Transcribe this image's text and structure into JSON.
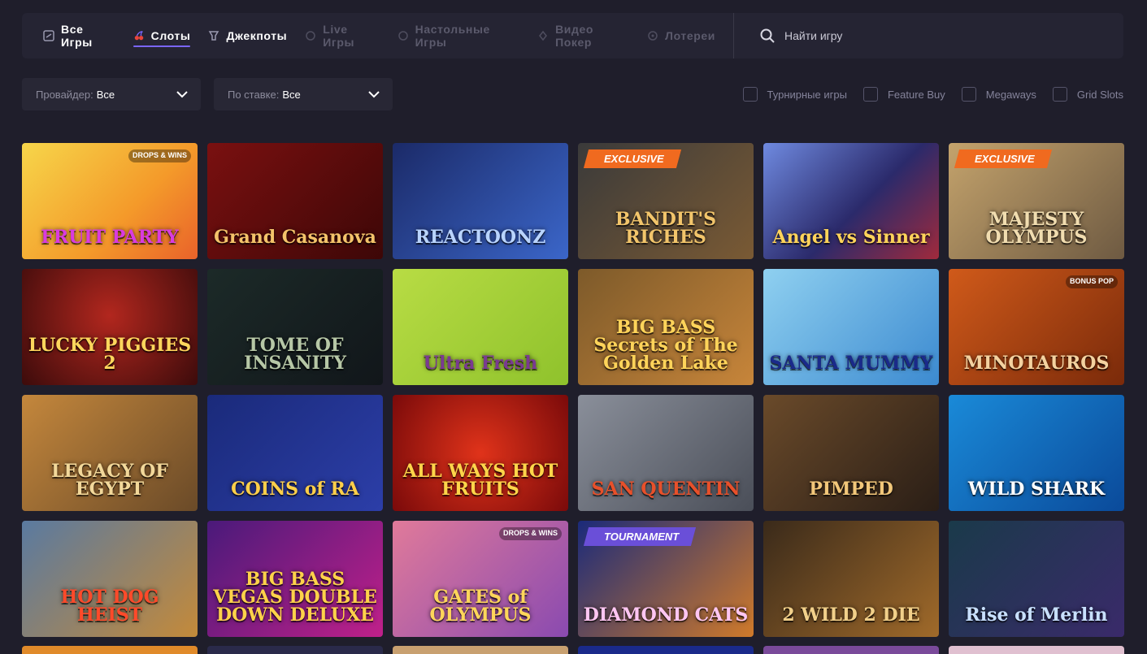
{
  "nav": {
    "categories": [
      {
        "label": "Все Игры",
        "icon": "all-games-icon",
        "active": false,
        "dim": false
      },
      {
        "label": "Слоты",
        "icon": "slots-cherry-icon",
        "active": true,
        "dim": false
      },
      {
        "label": "Джекпоты",
        "icon": "jackpot-icon",
        "active": false,
        "dim": false
      },
      {
        "label": "Live Игры",
        "icon": "live-icon",
        "active": false,
        "dim": true
      },
      {
        "label": "Настольные Игры",
        "icon": "table-games-icon",
        "active": false,
        "dim": true
      },
      {
        "label": "Видео Покер",
        "icon": "video-poker-icon",
        "active": false,
        "dim": true
      },
      {
        "label": "Лотереи",
        "icon": "lottery-icon",
        "active": false,
        "dim": true
      }
    ],
    "search_placeholder": "Найти игру"
  },
  "filters": {
    "provider_key": "Провайдер:",
    "provider_value": "Все",
    "bet_key": "По ставке:",
    "bet_value": "Все",
    "checkboxes": [
      "Турнирные игры",
      "Feature Buy",
      "Megaways",
      "Grid Slots"
    ]
  },
  "games": [
    {
      "title": "FRUIT PARTY",
      "bg": "linear-gradient(135deg,#f6d64a,#f49a2a 60%,#e9622a)",
      "color": "#d93be0",
      "mark": "DROPS & WINS"
    },
    {
      "title": "Grand Casanova",
      "bg": "linear-gradient(135deg,#7a1010,#3d0707)",
      "color": "#f4c36a"
    },
    {
      "title": "REACTOONZ",
      "bg": "linear-gradient(135deg,#1b2a68,#3b66c9)",
      "color": "#b9d4ff"
    },
    {
      "title": "BANDIT'S RICHES",
      "bg": "linear-gradient(135deg,#3a3a3a,#7a5a34)",
      "color": "#f2c56b",
      "badge": "EXCLUSIVE",
      "badge_type": "exclusive"
    },
    {
      "title": "Angel vs Sinner",
      "bg": "linear-gradient(135deg,#6f8ae0,#2b2a6b 55%,#a02a3c)",
      "color": "#ffd45a"
    },
    {
      "title": "MAJESTY OLYMPUS",
      "bg": "linear-gradient(135deg,#c4a36c,#6e5a42)",
      "color": "#f1ddb0",
      "badge": "EXCLUSIVE",
      "badge_type": "exclusive"
    },
    {
      "title": "LUCKY PIGGIES 2",
      "bg": "radial-gradient(circle at 50% 40%,#b2271e,#3c0b0b)",
      "color": "#ffd65c"
    },
    {
      "title": "TOME OF INSANITY",
      "bg": "linear-gradient(135deg,#1c2a28,#11161a)",
      "color": "#b6c7a6"
    },
    {
      "title": "Ultra Fresh",
      "bg": "linear-gradient(135deg,#b8dc44,#8fc22c)",
      "color": "#7a3a92"
    },
    {
      "title": "BIG BASS Secrets of The Golden Lake",
      "bg": "linear-gradient(135deg,#7d5a2a,#c7853a)",
      "color": "#ffd45a"
    },
    {
      "title": "SANTA MUMMY",
      "bg": "linear-gradient(135deg,#8fd0f0,#3c8ad0)",
      "color": "#1a2a8a"
    },
    {
      "title": "MINOTAUROS",
      "bg": "linear-gradient(135deg,#d05a1a,#7a2a0a)",
      "color": "#f4d2a0",
      "mark": "BONUS POP"
    },
    {
      "title": "LEGACY OF EGYPT",
      "bg": "linear-gradient(135deg,#c4873c,#6a4a28)",
      "color": "#f2d89a"
    },
    {
      "title": "COINS of RA",
      "bg": "linear-gradient(135deg,#1a2a7a,#2c3ea8)",
      "color": "#ffcf4a"
    },
    {
      "title": "ALL WAYS HOT FRUITS",
      "bg": "radial-gradient(circle at 50% 50%,#e0331a,#7a0a0a)",
      "color": "#ffd54a"
    },
    {
      "title": "SAN QUENTIN",
      "bg": "linear-gradient(135deg,#8a8f9a,#4a4e58)",
      "color": "#e8502a"
    },
    {
      "title": "PIMPED",
      "bg": "linear-gradient(135deg,#6a4a2a,#2a1e16)",
      "color": "#f2c77a"
    },
    {
      "title": "WILD SHARK",
      "bg": "linear-gradient(135deg,#1a8ad8,#0a4a9a)",
      "color": "#ffffff"
    },
    {
      "title": "HOT DOG HEIST",
      "bg": "linear-gradient(135deg,#5a7aa0,#c48a3a)",
      "color": "#ff4a2a"
    },
    {
      "title": "BIG BASS VEGAS DOUBLE DOWN DELUXE",
      "bg": "linear-gradient(135deg,#4a1a7a,#c0208a)",
      "color": "#ffd24a"
    },
    {
      "title": "GATES of OLYMPUS",
      "bg": "linear-gradient(135deg,#e07a9a,#8a4ab0)",
      "color": "#ffd65a",
      "mark": "DROPS & WINS"
    },
    {
      "title": "DIAMOND CATS",
      "bg": "linear-gradient(135deg,#1a2a7a,#d07a2a)",
      "color": "#ffc6f2",
      "badge": "TOURNAMENT",
      "badge_type": "tournament"
    },
    {
      "title": "2 WILD 2 DIE",
      "bg": "linear-gradient(135deg,#3a2a1a,#a06a2a)",
      "color": "#f2d08a"
    },
    {
      "title": "Rise of Merlin",
      "bg": "linear-gradient(135deg,#1a3a4a,#3a2a6a)",
      "color": "#c8e0ff"
    }
  ],
  "partial_row_colors": [
    "#e08a2a",
    "#2a2a4a",
    "#c8a070",
    "#1a2a8a",
    "#7a4a9a",
    "#e0c0d0"
  ]
}
